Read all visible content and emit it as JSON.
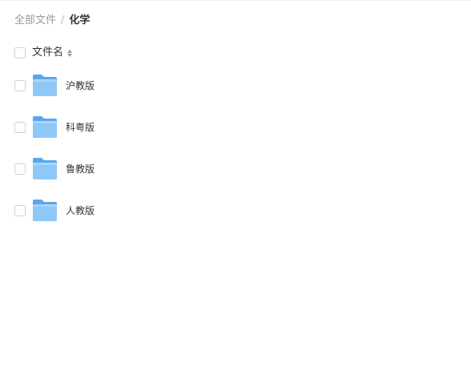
{
  "breadcrumb": {
    "root": "全部文件",
    "separator": "/",
    "current": "化学"
  },
  "list_header": {
    "name_column": "文件名",
    "sort_icon": "sort-icon"
  },
  "files": [
    {
      "name": "沪教版",
      "icon": "folder-icon"
    },
    {
      "name": "科粤版",
      "icon": "folder-icon"
    },
    {
      "name": "鲁教版",
      "icon": "folder-icon"
    },
    {
      "name": "人教版",
      "icon": "folder-icon"
    }
  ],
  "colors": {
    "folder_back": "#5aa6ea",
    "folder_front": "#8ec8f8",
    "text": "#333333",
    "muted": "#999999"
  }
}
